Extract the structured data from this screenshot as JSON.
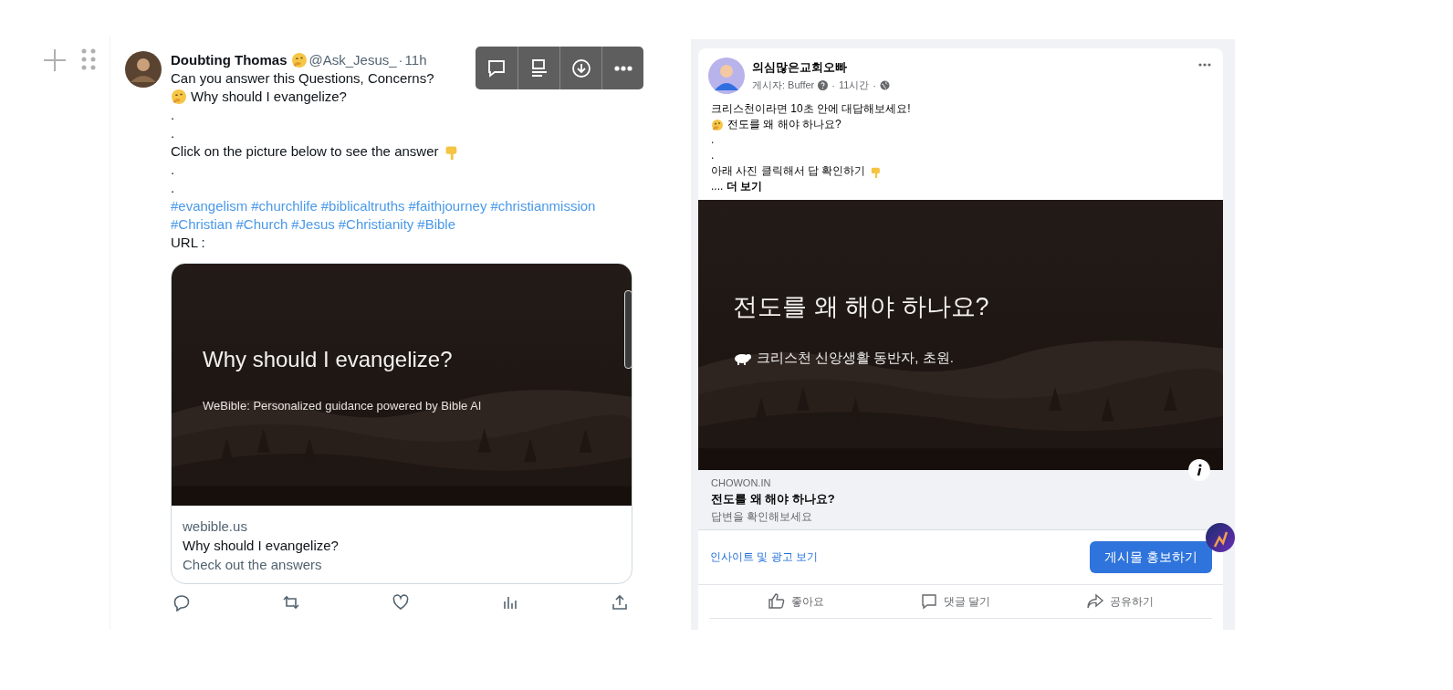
{
  "tweet": {
    "author": {
      "text": "Doubting Thomas",
      "kind": "thinking-last"
    },
    "handle": "@Ask_Jesus_",
    "separator": "·",
    "time": "11h",
    "lines": [
      {
        "text": "Can you answer this Questions, Concerns?"
      },
      {
        "text": "Why should I evangelize?",
        "kind": "thinking-first"
      },
      {
        "text": "."
      },
      {
        "text": "."
      },
      {
        "text": "Click on the picture below to see the answer",
        "kind": "pointing-last"
      },
      {
        "text": "."
      },
      {
        "text": "."
      }
    ],
    "hashtag_lines": [
      [
        "#evangelism",
        "#churchlife",
        "#biblicaltruths",
        "#faithjourney",
        "#christianmission"
      ],
      [
        "#Christian",
        "#Church",
        "#Jesus",
        "#Christianity",
        "#Bible"
      ]
    ],
    "url_label": "URL :",
    "card": {
      "image_title": "Why should I evangelize?",
      "image_subtitle": "WeBible: Personalized guidance powered by Bible AI",
      "domain": "webible.us",
      "title": "Why should I evangelize?",
      "description": "Check out the answers"
    }
  },
  "facebook_post": {
    "page_name": "의심많은교회오빠",
    "posted_by": "게시자: Buffer",
    "separator": "·",
    "time": "11시간",
    "lines": [
      {
        "text": "크리스천이라면 10초 안에 대답해보세요!"
      },
      {
        "text": "전도를 왜 해야 하나요?",
        "kind": "thinking-first"
      },
      {
        "text": "."
      },
      {
        "text": "."
      },
      {
        "text": "아래 사진 클릭해서 답 확인하기",
        "kind": "pointing-last"
      }
    ],
    "more": ".... **더 보기**",
    "card": {
      "image_title": "전도를 왜 해야 하나요?",
      "image_subtitle": "크리스천 신앙생활 동반자, 초원.",
      "domain": "CHOWON.IN",
      "title": "전도를 왜 해야 하나요?",
      "description": "답변을 확인해보세요"
    },
    "insights_link": "인사이트 및 광고 보기",
    "promote_button": "게시물 홍보하기",
    "actions": [
      {
        "kind": "like",
        "label": "좋아요"
      },
      {
        "kind": "comment",
        "label": "댓글 달기"
      },
      {
        "kind": "share",
        "label": "공유하기"
      }
    ]
  }
}
